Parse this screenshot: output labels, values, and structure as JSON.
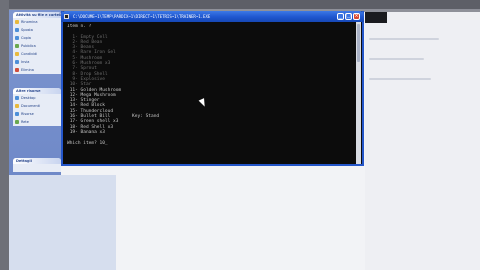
{
  "console": {
    "title": "C:\\DOCUME~1\\TEMP\\PARDIX~1\\DIRECT~1\\TETRIS~1\\TRAINER~1.EXE",
    "lines": [
      "Item n. ?",
      "",
      "  1- Empty Cell",
      "  2- Red Bean",
      "  3- Beans",
      "  4- Rare Iron Gel",
      "  5- Mushroom",
      "  6- Mushroom x3",
      "  7- Sprout",
      "  8- Drop Shell",
      "  9- Explosive",
      " 10- Star",
      " 11- Golden Mushroom",
      " 12- Mega Mushroom",
      " 13- Stinger",
      " 14- Red Block",
      " 15- Thundercloud",
      " 16- Bullet Bill        Key: Stand",
      " 17- Green shell x3",
      " 18- Red Shell x3",
      " 19- Banana x3",
      "",
      "Which item? 10_"
    ],
    "dim_line_count": 12
  },
  "taskpane": {
    "box1": {
      "header": "Attività su file e cartelle",
      "items": [
        "Rinomina",
        "Sposta",
        "Copia",
        "Pubblica",
        "Condividi",
        "Invia",
        "Elimina"
      ]
    },
    "box2": {
      "header": "Altre risorse",
      "items": [
        "Desktop",
        "Documenti",
        "Risorse",
        "Rete"
      ]
    },
    "box3": {
      "header": "Dettagli"
    }
  }
}
